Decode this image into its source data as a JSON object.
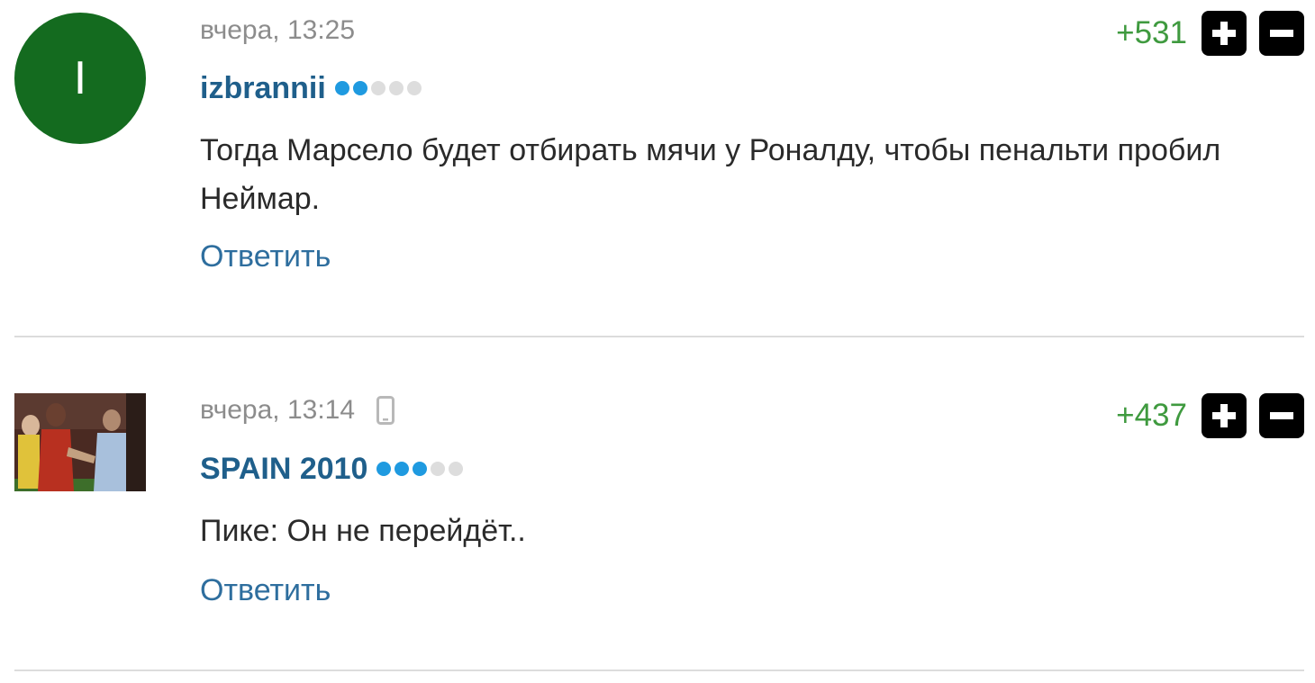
{
  "comments": [
    {
      "avatar_letter": "I",
      "avatar_color": "#146b1f",
      "time": "вчера, 13:25",
      "author": "izbrannii",
      "rank_dots_total": 5,
      "rank_dots_filled": 2,
      "score": "+531",
      "text": "Тогда Марсело будет отбирать мячи у Роналду, чтобы пенальти пробил Неймар.",
      "reply_label": "Ответить"
    },
    {
      "avatar_type": "photo",
      "time": "вчера, 13:14",
      "device_icon": "mobile-phone-icon",
      "author": "SPAIN 2010",
      "rank_dots_total": 5,
      "rank_dots_filled": 3,
      "score": "+437",
      "text": "Пике: Он не перейдёт..",
      "reply_label": "Ответить"
    }
  ],
  "colors": {
    "author": "#1f5f8b",
    "score_positive": "#3f9a3f",
    "reply_link": "#2e6e9e",
    "rank_dot_active": "#1f9ae0",
    "vote_button": "#000000"
  },
  "icons": {
    "upvote": "plus-icon",
    "downvote": "minus-icon"
  }
}
